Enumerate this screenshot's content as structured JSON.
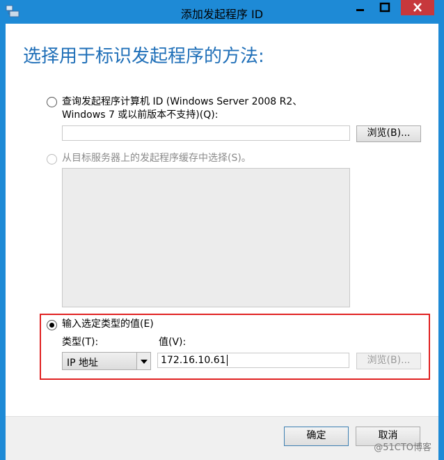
{
  "window": {
    "title": "添加发起程序 ID",
    "controls": [
      "minimize-icon",
      "maximize-icon",
      "close-icon"
    ]
  },
  "heading": "选择用于标识发起程序的方法:",
  "option_query": {
    "label_line1": "查询发起程序计算机 ID (Windows Server 2008 R2、",
    "label_line2": "Windows 7 或以前版本不支持)(Q):",
    "value": "",
    "browse_label": "浏览(B)..."
  },
  "option_cache": {
    "label": "从目标服务器上的发起程序缓存中选择(S)。"
  },
  "option_value": {
    "label": "输入选定类型的值(E)",
    "type_label": "类型(T):",
    "value_label": "值(V):",
    "type_selected": "IP 地址",
    "value": "172.16.10.61",
    "browse_label": "浏览(B)..."
  },
  "footer": {
    "ok_label": "确定",
    "cancel_label": "取消"
  },
  "watermark": "@51CTO博客",
  "colors": {
    "frame": "#1e8ad6",
    "heading": "#1f6fb8",
    "close_button": "#c7383c",
    "highlight": "#e02020"
  }
}
